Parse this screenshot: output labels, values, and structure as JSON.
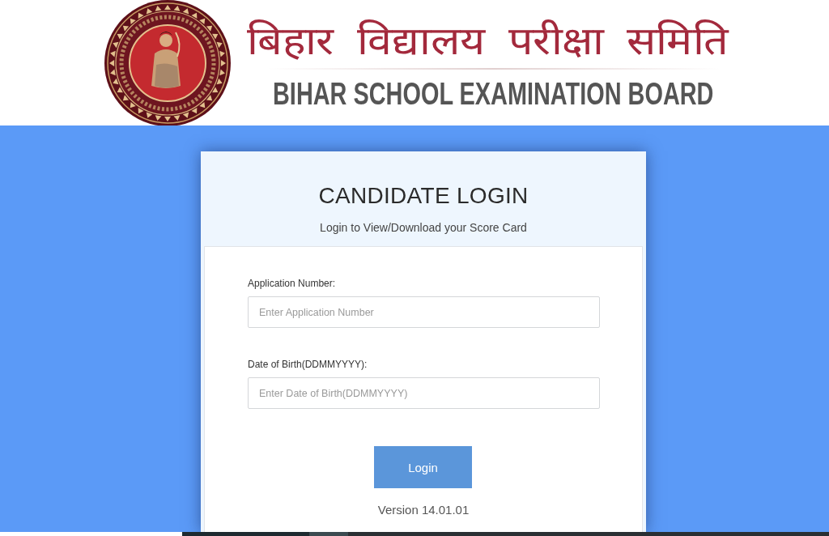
{
  "header": {
    "title_hindi": "बिहार विद्यालय परीक्षा समिति",
    "title_english": "BIHAR SCHOOL EXAMINATION BOARD"
  },
  "login_card": {
    "title": "CANDIDATE LOGIN",
    "subtitle": "Login to View/Download your Score Card",
    "fields": [
      {
        "label": "Application Number:",
        "placeholder": "Enter Application Number"
      },
      {
        "label": "Date of Birth(DDMMYYYY):",
        "placeholder": "Enter Date of Birth(DDMMYYYY)"
      }
    ],
    "button": "Login",
    "version": "Version 14.01.01"
  }
}
